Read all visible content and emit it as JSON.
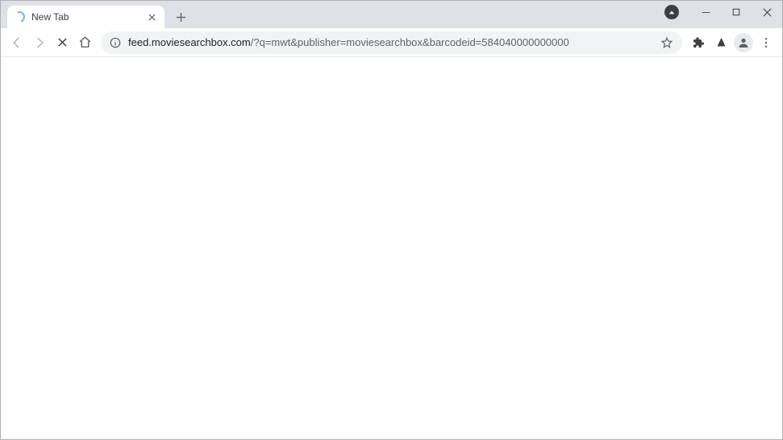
{
  "tab": {
    "title": "New Tab"
  },
  "omnibox": {
    "host": "feed.moviesearchbox.com",
    "path": "/?q=mwt&publisher=moviesearchbox&barcodeid=584040000000000"
  }
}
